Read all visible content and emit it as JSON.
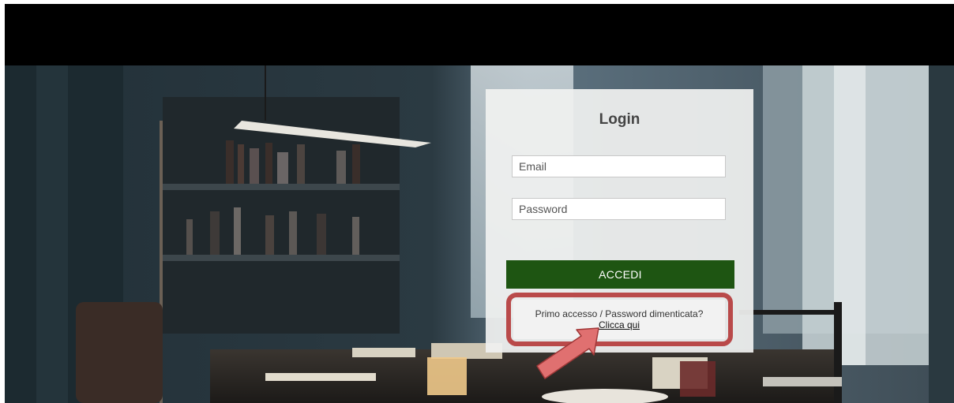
{
  "login": {
    "title": "Login",
    "email_placeholder": "Email",
    "password_placeholder": "Password",
    "submit_label": "ACCEDI"
  },
  "help": {
    "text": "Primo accesso / Password dimenticata?",
    "link_label": "Clicca qui"
  },
  "colors": {
    "top_bar": "#000000",
    "submit_button": "#1e5512",
    "annotation": "#b94a4a",
    "arrow": "#e07070"
  },
  "icons": {
    "annotation_arrow": "arrow-pointer-icon"
  }
}
